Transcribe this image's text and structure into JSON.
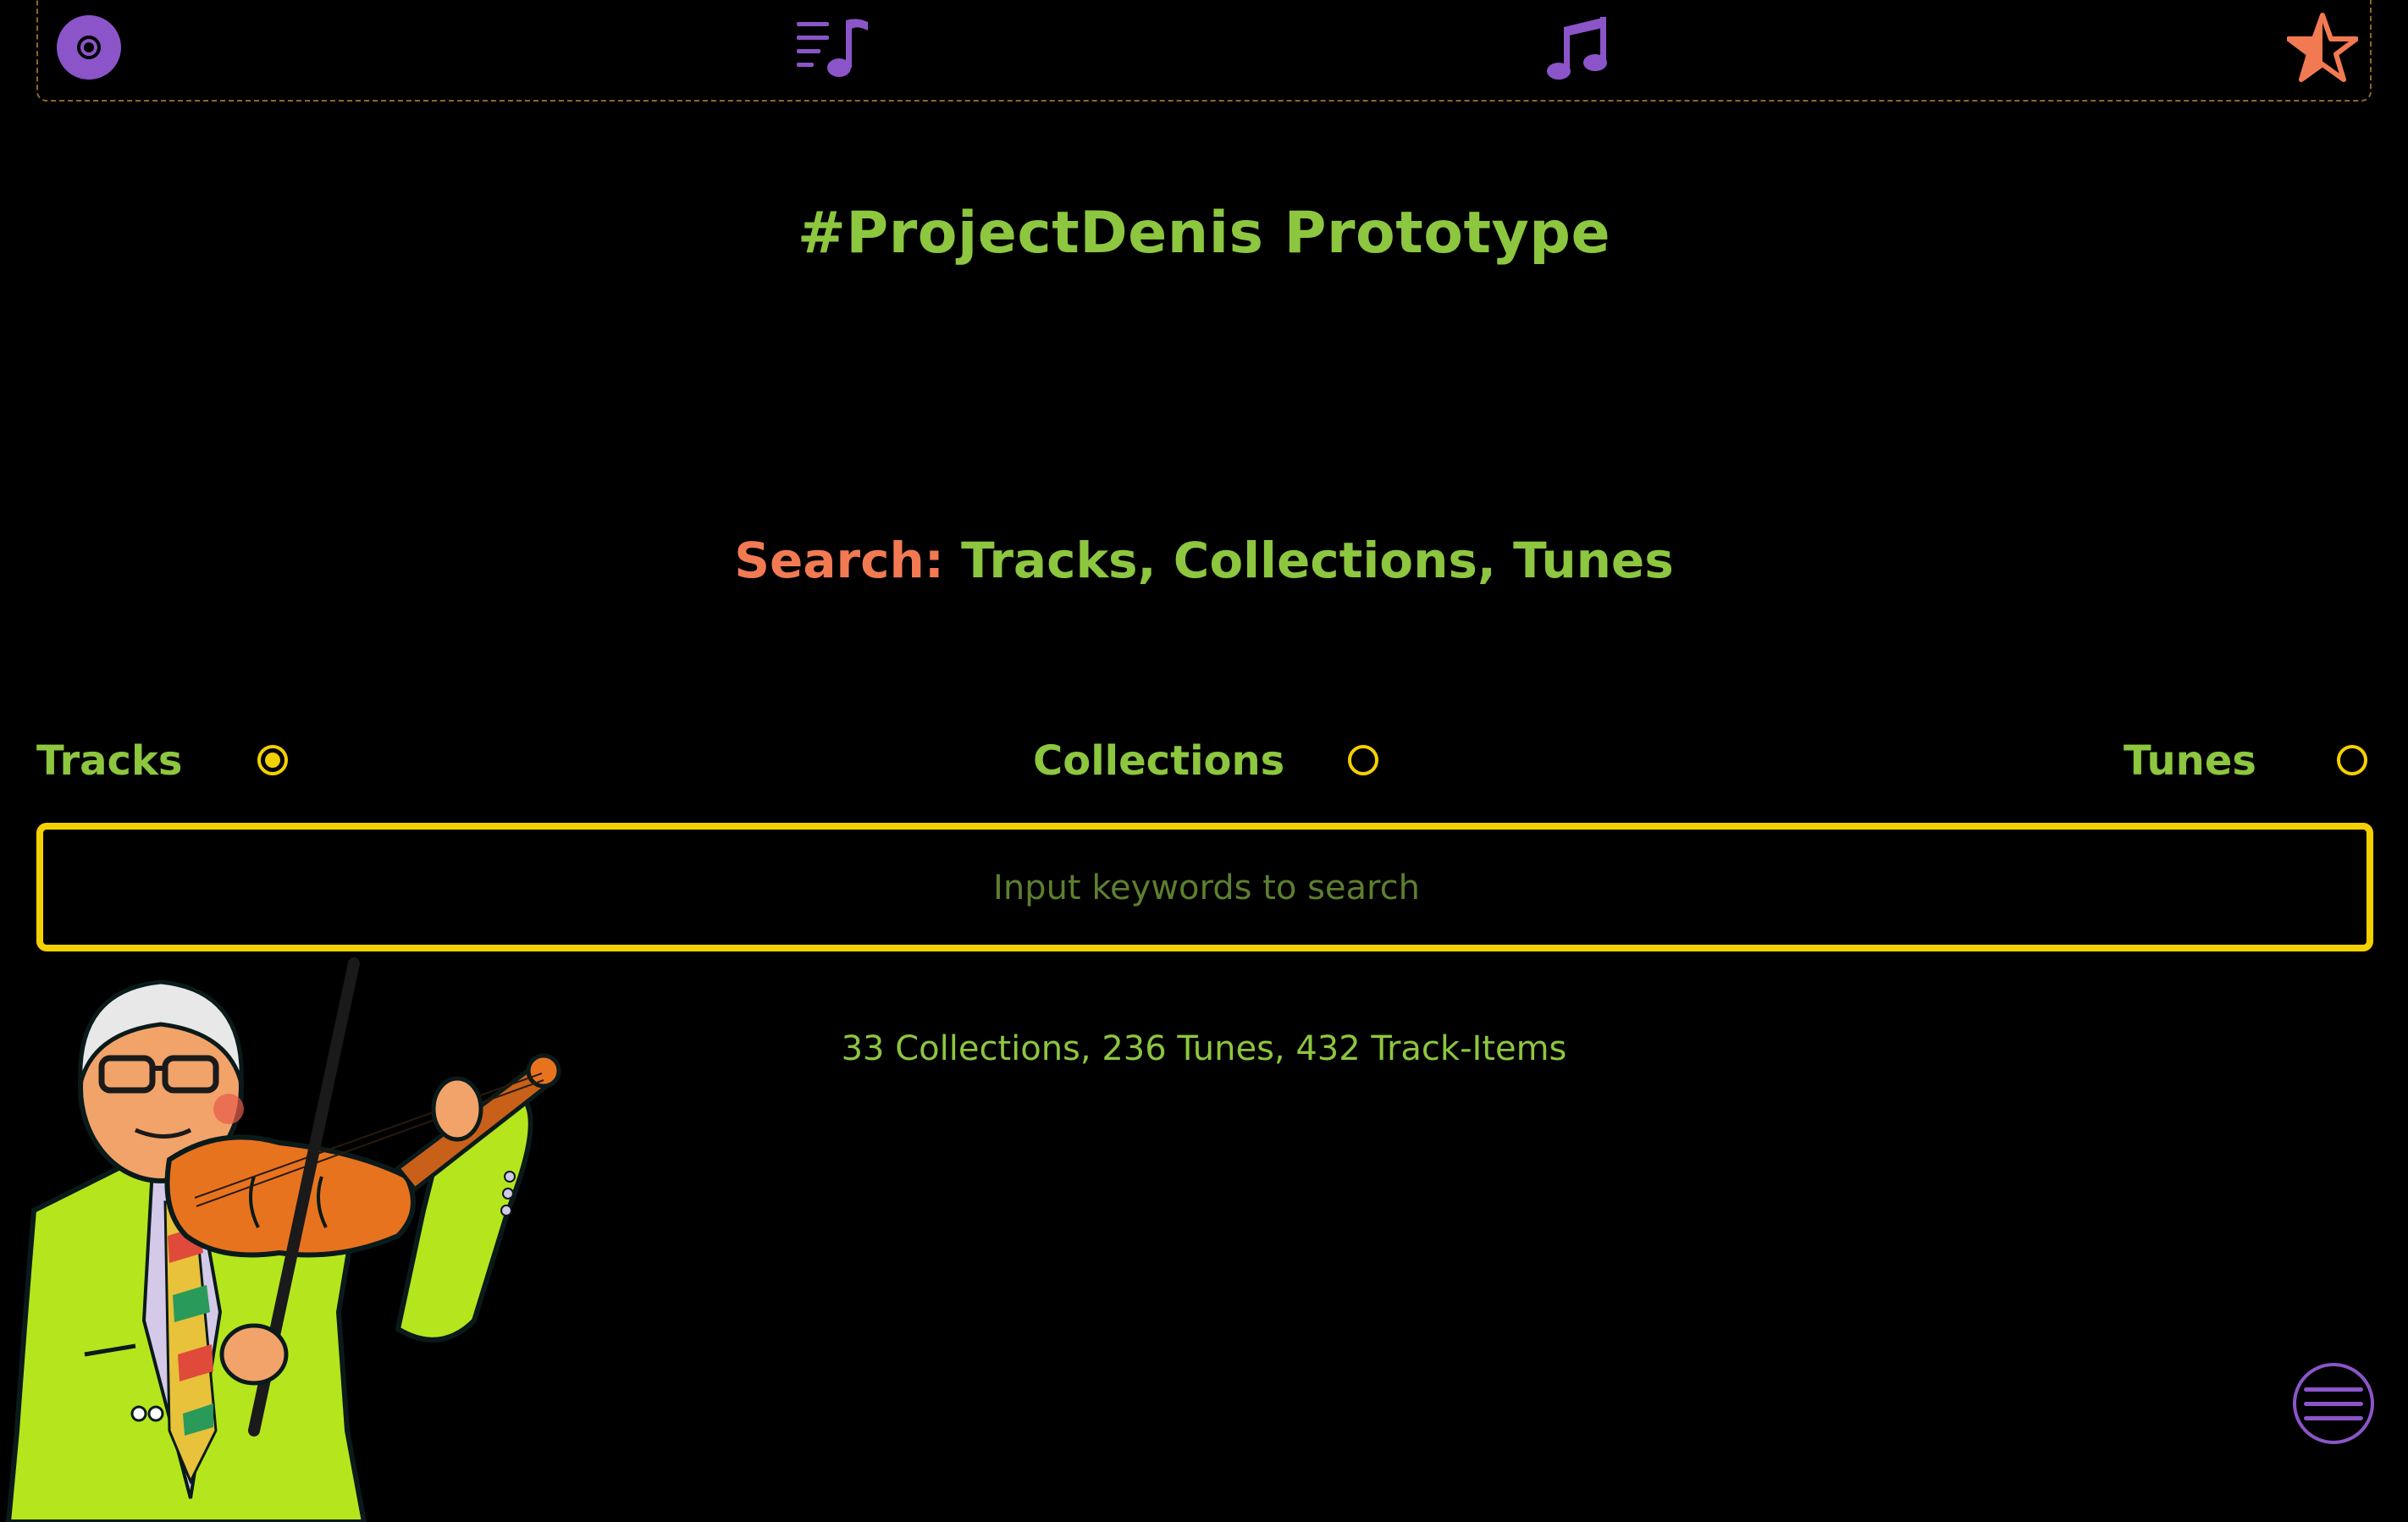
{
  "nav": {
    "items": [
      {
        "name": "disc-icon",
        "color": "#8b55c9"
      },
      {
        "name": "playlist-icon",
        "color": "#8b55c9"
      },
      {
        "name": "music-note-icon",
        "color": "#8b55c9"
      },
      {
        "name": "star-icon",
        "color": "#f27a52"
      }
    ]
  },
  "header": {
    "title": "#ProjectDenis Prototype"
  },
  "search": {
    "heading_prefix": "Search:",
    "heading_rest": " Tracks, Collections, Tunes",
    "options": [
      {
        "label": "Tracks",
        "checked": true
      },
      {
        "label": "Collections",
        "checked": false
      },
      {
        "label": "Tunes",
        "checked": false
      }
    ],
    "placeholder": "Input keywords to search",
    "value": ""
  },
  "stats": {
    "text": "33 Collections, 236 Tunes, 432 Track-Items"
  },
  "menu": {
    "icon": "hamburger-menu-icon"
  },
  "colors": {
    "background": "#000000",
    "green": "#8dc63f",
    "orange": "#f27a52",
    "yellow": "#f5d000",
    "purple": "#8b55c9"
  }
}
